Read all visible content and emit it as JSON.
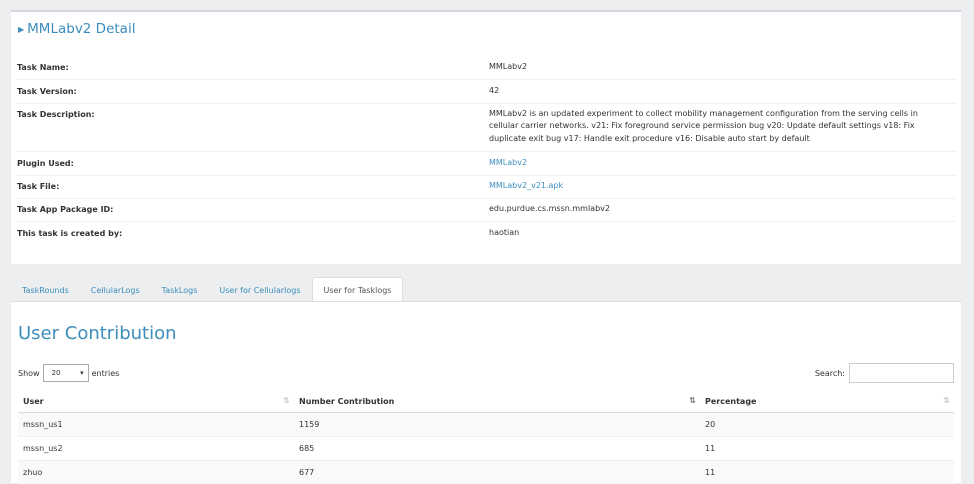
{
  "detail": {
    "title": "MMLabv2 Detail",
    "rows": [
      {
        "label": "Task Name:",
        "value": "MMLabv2"
      },
      {
        "label": "Task Version:",
        "value": "42"
      },
      {
        "label": "Task Description:",
        "value": "MMLabv2 is an updated experiment to collect mobility management configuration from the serving cells in cellular carrier networks. v21: Fix foreground service permission bug v20: Update default settings v18: Fix duplicate exit bug v17: Handle exit procedure v16: Disable auto start by default"
      },
      {
        "label": "Plugin Used:",
        "value": "MMLabv2"
      },
      {
        "label": "Task File:",
        "value": "MMLabv2_v21.apk"
      },
      {
        "label": "Task App Package ID:",
        "value": "edu.purdue.cs.mssn.mmlabv2"
      },
      {
        "label": "This task is created by:",
        "value": "haotian"
      }
    ]
  },
  "tabs": [
    {
      "label": "TaskRounds"
    },
    {
      "label": "CellularLogs"
    },
    {
      "label": "TaskLogs"
    },
    {
      "label": "User for Cellularlogs"
    },
    {
      "label": "User for Tasklogs",
      "active": true
    }
  ],
  "contribution": {
    "title": "User Contribution",
    "show_label": "Show",
    "entries_value": "20",
    "entries_label": "entries",
    "search_label": "Search:",
    "search_value": "",
    "columns": [
      "User",
      "Number Contribution",
      "Percentage"
    ],
    "rows": [
      [
        "mssn_us1",
        "1159",
        "20"
      ],
      [
        "mssn_us2",
        "685",
        "11"
      ],
      [
        "zhuo",
        "677",
        "11"
      ]
    ]
  },
  "colors": {
    "accent": "#3c8dbc",
    "background": "#eceeef"
  }
}
